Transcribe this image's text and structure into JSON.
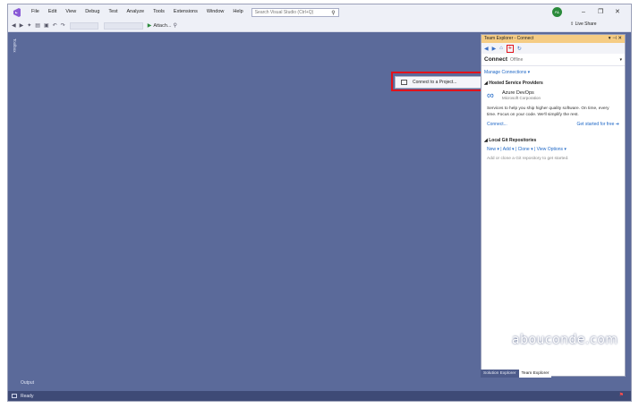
{
  "menubar": {
    "items": [
      "File",
      "Edit",
      "View",
      "Debug",
      "Test",
      "Analyze",
      "Tools",
      "Extensions",
      "Window",
      "Help"
    ],
    "search_placeholder": "Search Visual Studio (Ctrl+Q)",
    "avatar_initials": "AL"
  },
  "toolbar": {
    "attach_label": "Attach...",
    "live_share": "Live Share"
  },
  "toolbox_label": "Toolbox",
  "context_menu": {
    "item": "Connect to a Project..."
  },
  "team_explorer": {
    "title": "Team Explorer - Connect",
    "header": "Connect",
    "status": "Offline",
    "manage_connections": "Manage Connections",
    "hosted_section": "Hosted Service Providers",
    "provider_name": "Azure DevOps",
    "provider_company": "Microsoft Corporation",
    "provider_desc": "Services to help you ship higher quality software. On time, every time. Focus on your code. We'll simplify the rest.",
    "connect_link": "Connect...",
    "get_started": "Get started for free",
    "git_section": "Local Git Repositories",
    "git_actions": [
      "New",
      "Add",
      "Clone",
      "View Options"
    ],
    "git_desc": "Add or clone a Git repository to get started."
  },
  "tabs": [
    "Solution Explorer",
    "Team Explorer"
  ],
  "watermark": "abouconde.com",
  "output_label": "Output",
  "status": "Ready",
  "colors": {
    "editor_bg": "#5b6a9a",
    "highlight": "#e3121b",
    "title_accent": "#f5cc84",
    "link": "#1e67c6"
  }
}
